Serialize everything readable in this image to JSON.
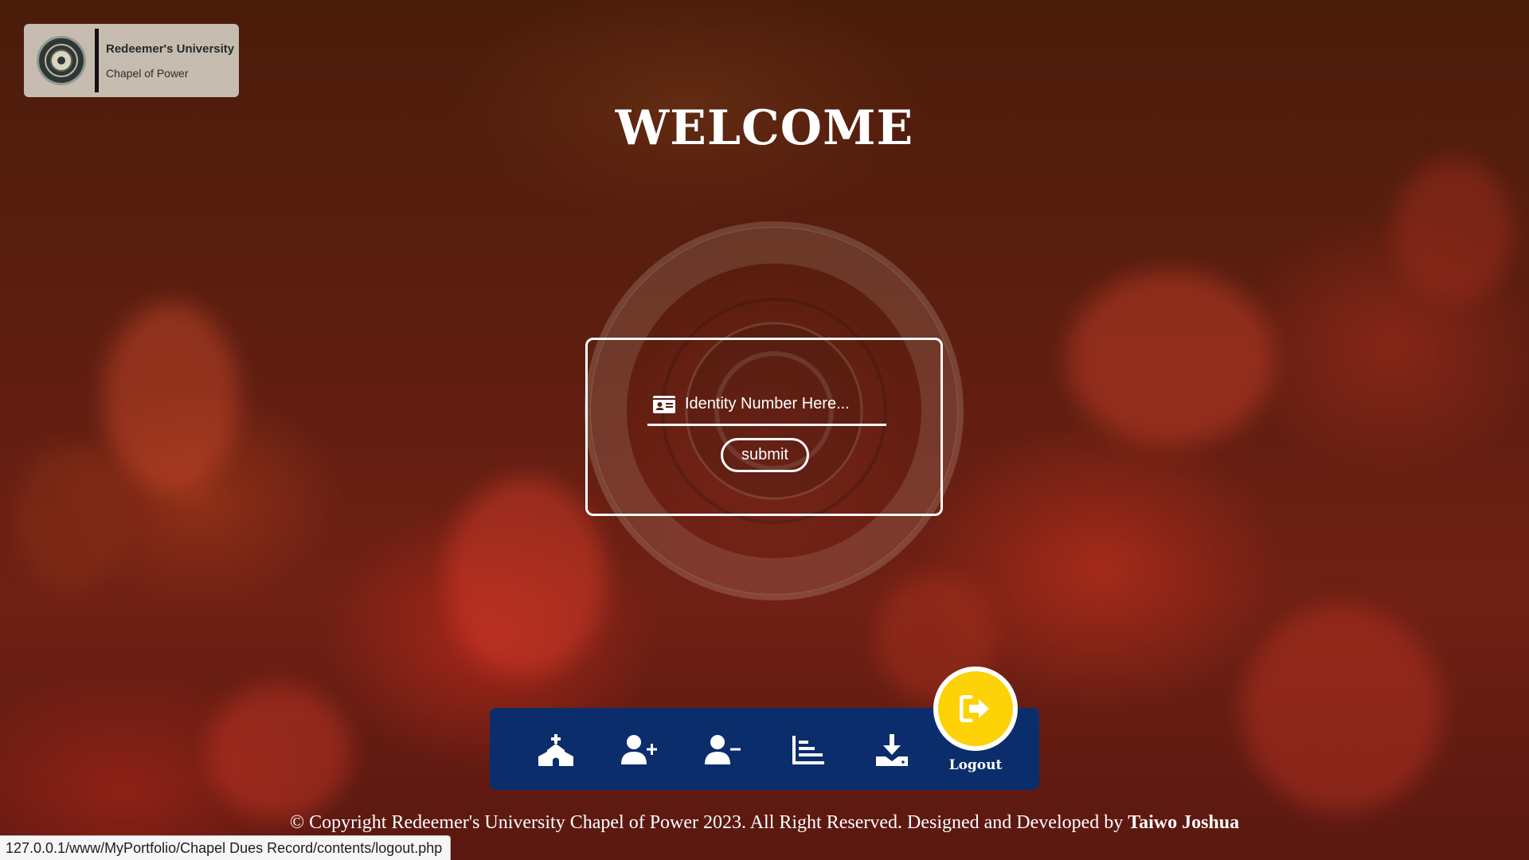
{
  "logo": {
    "title": "Redeemer's University",
    "subtitle": "Chapel of Power",
    "seal_icon": "university-seal"
  },
  "welcome": "WELCOME",
  "login": {
    "placeholder": "Identity Number Here...",
    "value": "",
    "field_icon": "id-card-icon",
    "submit_label": "submit"
  },
  "nav": {
    "items": [
      {
        "name": "church-icon",
        "title": "Home"
      },
      {
        "name": "user-plus-icon",
        "title": "Add User"
      },
      {
        "name": "user-minus-icon",
        "title": "Remove User"
      },
      {
        "name": "bar-chart-icon",
        "title": "Records"
      },
      {
        "name": "download-icon",
        "title": "Download"
      }
    ],
    "logout_label": "Logout",
    "logout_icon": "logout-icon"
  },
  "footer": {
    "text": "© Copyright Redeemer's University Chapel of Power 2023. All Right Reserved. Designed and Developed by ",
    "author": "Taiwo Joshua"
  },
  "status_url": "127.0.0.1/www/MyPortfolio/Chapel Dues Record/contents/logout.php",
  "colors": {
    "nav_background": "#0b2d6b",
    "logout_accent": "#fdd207",
    "text": "#ffffff"
  }
}
